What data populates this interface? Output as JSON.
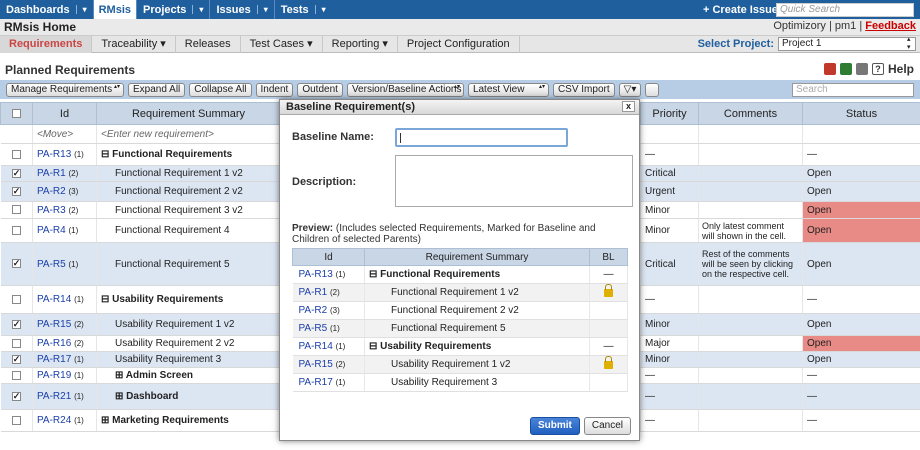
{
  "topnav": {
    "items": [
      {
        "label": "Dashboards",
        "dd": "|▾"
      },
      {
        "label": "RMsis",
        "dd": ""
      },
      {
        "label": "Projects",
        "dd": "|▾"
      },
      {
        "label": "Issues",
        "dd": "|▾"
      },
      {
        "label": "Tests",
        "dd": "|▾"
      }
    ],
    "create_issue": "+ Create Issue",
    "quick_search_placeholder": "Quick Search"
  },
  "titlebar": {
    "app_name": "RMsis Home",
    "optimizory": "Optimizory",
    "separator": "|",
    "user": "pm1",
    "feedback": "Feedback"
  },
  "menubar": {
    "items": [
      "Requirements",
      "Traceability ▾",
      "Releases",
      "Test Cases ▾",
      "Reporting ▾",
      "Project Configuration"
    ],
    "select_project_label": "Select Project:",
    "select_project_value": "Project 1"
  },
  "page": {
    "heading": "Planned Requirements",
    "help": "Help"
  },
  "toolbar": {
    "manage": "Manage Requirements",
    "expand": "Expand All",
    "collapse": "Collapse All",
    "indent": "Indent",
    "outdent": "Outdent",
    "version": "Version/Baseline Actions",
    "latest": "Latest View",
    "csv": "CSV Import",
    "filter": "▽▾",
    "search_placeholder": "Search"
  },
  "grid": {
    "headers": {
      "id": "Id",
      "summary": "Requirement Summary",
      "priority": "Priority",
      "comments": "Comments",
      "status": "Status"
    },
    "move_row": {
      "id": "<Move>",
      "summary": "<Enter new requirement>"
    },
    "rows": [
      {
        "id": "PA-R13",
        "v": "(1)",
        "summary": "⊟ Functional Requirements",
        "priority": "—",
        "comment": "",
        "status": "—",
        "checked": false
      },
      {
        "id": "PA-R1",
        "v": "(2)",
        "summary": "Functional Requirement 1 v2",
        "priority": "Critical",
        "comment": "",
        "status": "Open",
        "checked": true
      },
      {
        "id": "PA-R2",
        "v": "(3)",
        "summary": "Functional Requirement 2 v2",
        "priority": "Urgent",
        "comment": "",
        "status": "Open",
        "checked": true
      },
      {
        "id": "PA-R3",
        "v": "(2)",
        "summary": "Functional Requirement 3 v2",
        "priority": "Minor",
        "comment": "",
        "status": "Open",
        "checked": false
      },
      {
        "id": "PA-R4",
        "v": "(1)",
        "summary": "Functional Requirement 4",
        "priority": "Minor",
        "comment": "Only latest comment will shown in the cell.",
        "status": "Open",
        "checked": false
      },
      {
        "id": "PA-R5",
        "v": "(1)",
        "summary": "Functional Requirement 5",
        "priority": "Critical",
        "comment": "Rest of the comments will be seen by clicking on the respective cell.",
        "status": "Open",
        "checked": true
      },
      {
        "id": "PA-R14",
        "v": "(1)",
        "summary": "⊟ Usability Requirements",
        "priority": "—",
        "comment": "",
        "status": "—",
        "checked": false
      },
      {
        "id": "PA-R15",
        "v": "(2)",
        "summary": "Usability Requirement 1 v2",
        "priority": "Minor",
        "comment": "",
        "status": "Open",
        "checked": true
      },
      {
        "id": "PA-R16",
        "v": "(2)",
        "summary": "Usability Requirement 2 v2",
        "priority": "Major",
        "comment": "",
        "status": "Open",
        "checked": false
      },
      {
        "id": "PA-R17",
        "v": "(1)",
        "summary": "Usability Requirement 3",
        "priority": "Minor",
        "comment": "",
        "status": "Open",
        "checked": true
      },
      {
        "id": "PA-R19",
        "v": "(1)",
        "summary": "⊞ Admin Screen",
        "priority": "—",
        "comment": "",
        "status": "—",
        "checked": false
      },
      {
        "id": "PA-R21",
        "v": "(1)",
        "summary": "⊞ Dashboard",
        "priority": "—",
        "comment": "",
        "status": "—",
        "checked": true
      },
      {
        "id": "PA-R24",
        "v": "(1)",
        "summary": "⊞ Marketing Requirements",
        "priority": "—",
        "comment": "",
        "status": "—",
        "checked": false
      }
    ]
  },
  "dialog": {
    "title": "Baseline Requirement(s)",
    "close": "x",
    "baseline_name_label": "Baseline Name:",
    "description_label": "Description:",
    "preview_bold": "Preview:",
    "preview_text": " (Includes selected Requirements, Marked for Baseline and Children of selected Parents)",
    "headers": {
      "id": "Id",
      "summary": "Requirement Summary",
      "bl": "BL"
    },
    "rows": [
      {
        "id": "PA-R13",
        "v": "(1)",
        "summary": "⊟ Functional Requirements",
        "bl": "—",
        "lock": false,
        "parent": true
      },
      {
        "id": "PA-R1",
        "v": "(2)",
        "summary": "Functional Requirement 1 v2",
        "bl": "",
        "lock": true,
        "parent": false
      },
      {
        "id": "PA-R2",
        "v": "(3)",
        "summary": "Functional Requirement 2 v2",
        "bl": "",
        "lock": false,
        "parent": false
      },
      {
        "id": "PA-R5",
        "v": "(1)",
        "summary": "Functional Requirement 5",
        "bl": "",
        "lock": false,
        "parent": false
      },
      {
        "id": "PA-R14",
        "v": "(1)",
        "summary": "⊟ Usability Requirements",
        "bl": "—",
        "lock": false,
        "parent": true
      },
      {
        "id": "PA-R15",
        "v": "(2)",
        "summary": "Usability Requirement 1 v2",
        "bl": "",
        "lock": true,
        "parent": false
      },
      {
        "id": "PA-R17",
        "v": "(1)",
        "summary": "Usability Requirement 3",
        "bl": "",
        "lock": false,
        "parent": false
      }
    ],
    "submit": "Submit",
    "cancel": "Cancel"
  }
}
